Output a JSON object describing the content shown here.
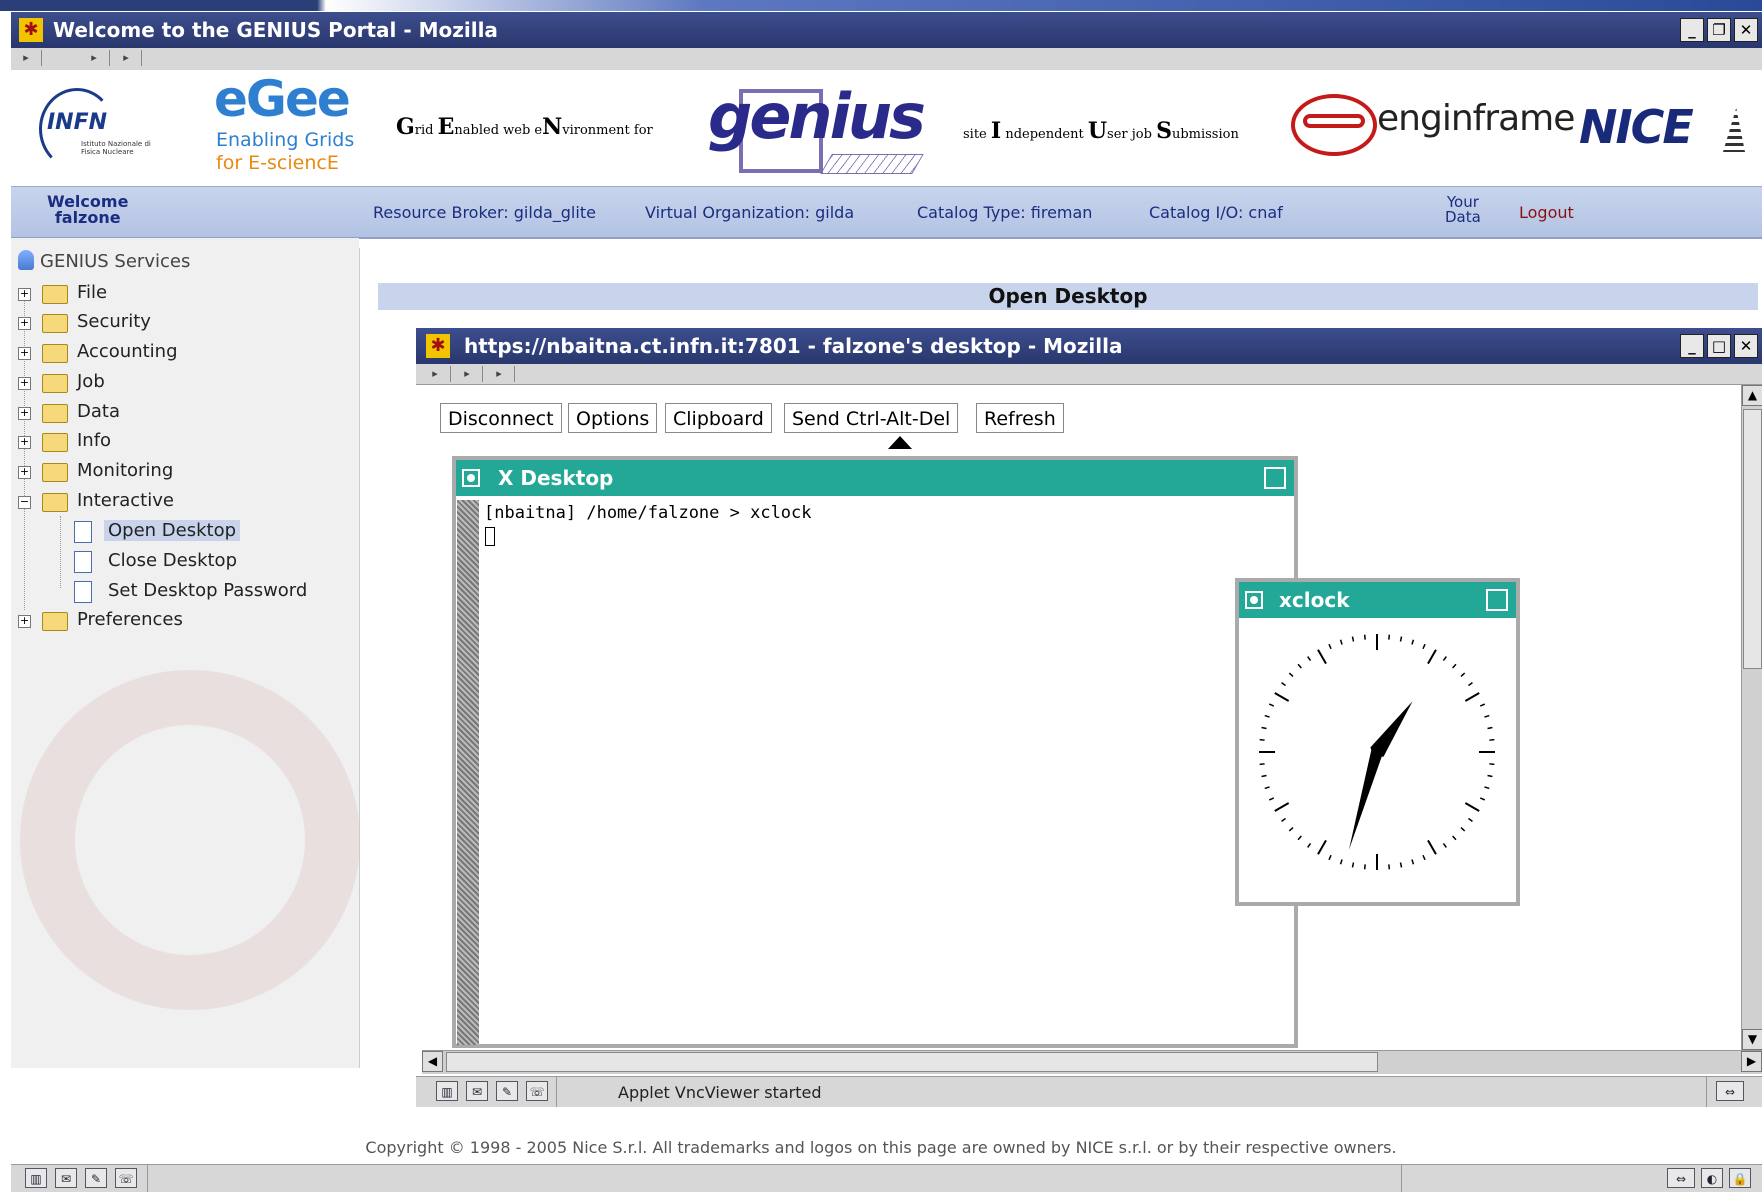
{
  "outer_window": {
    "title": "Welcome to the GENIUS Portal - Mozilla"
  },
  "header": {
    "infn_logo": {
      "text": "INFN",
      "sub": "Istituto Nazionale di Fisica Nucleare"
    },
    "egee_logo": {
      "text": "eGee",
      "tag1": "Enabling Grids",
      "tag2": "for E-sciencE"
    },
    "genius_caption": [
      {
        "cap": "G",
        "rest": "rid "
      },
      {
        "cap": "E",
        "rest": "nabled web e"
      },
      {
        "cap": "N",
        "rest": "vironment for"
      }
    ],
    "genius_logo": "genius",
    "siu_caption": [
      {
        "cap": "",
        "rest": "site "
      },
      {
        "cap": "I",
        "rest": " ndependent "
      },
      {
        "cap": "U",
        "rest": "ser job "
      },
      {
        "cap": "S",
        "rest": "ubmission"
      }
    ],
    "enginframe_logo": "enginframe",
    "nice_logo": "NICE"
  },
  "userbar": {
    "welcome": "Welcome",
    "user": "falzone",
    "resource_broker": "Resource Broker: gilda_glite",
    "vo": "Virtual Organization: gilda",
    "catalog_type": "Catalog Type: fireman",
    "catalog_io": "Catalog I/O: cnaf",
    "your_data_1": "Your",
    "your_data_2": "Data",
    "logout": "Logout"
  },
  "sidebar": {
    "root": "GENIUS Services",
    "items": [
      "File",
      "Security",
      "Accounting",
      "Job",
      "Data",
      "Info",
      "Monitoring",
      "Interactive"
    ],
    "interactive_children": [
      "Open Desktop",
      "Close Desktop",
      "Set Desktop Password"
    ],
    "preferences": "Preferences",
    "selected": "Open Desktop"
  },
  "main": {
    "heading": "Open Desktop"
  },
  "inner_window": {
    "title": "https://nbaitna.ct.infn.it:7801 - falzone's desktop - Mozilla",
    "buttons": [
      "Disconnect",
      "Options",
      "Clipboard",
      "Send Ctrl-Alt-Del",
      "Refresh"
    ]
  },
  "x_desktop": {
    "title": "X Desktop",
    "terminal_line": "[nbaitna] /home/falzone > xclock"
  },
  "xclock": {
    "title": "xclock",
    "hour_hand_angle_deg": 35,
    "minute_hand_angle_deg": 196
  },
  "inner_status": {
    "text": "Applet VncViewer started"
  },
  "footer": {
    "copyright": "Copyright © 1998 - 2005 Nice S.r.l. All trademarks and logos on this page are owned by NICE s.r.l. or by their respective owners."
  },
  "colors": {
    "title_bar": "#3d4e8e",
    "user_bar": "#c8d4ec",
    "x_title": "#23a898",
    "link_blue": "#1a2d80"
  },
  "icons": {
    "app": "mozilla-star-icon",
    "folder": "folder-icon",
    "document": "document-icon",
    "status": [
      "navigator-icon",
      "mail-icon",
      "composer-icon",
      "chat-icon"
    ],
    "security": [
      "connection-icon",
      "cookie-icon",
      "lock-icon"
    ]
  }
}
